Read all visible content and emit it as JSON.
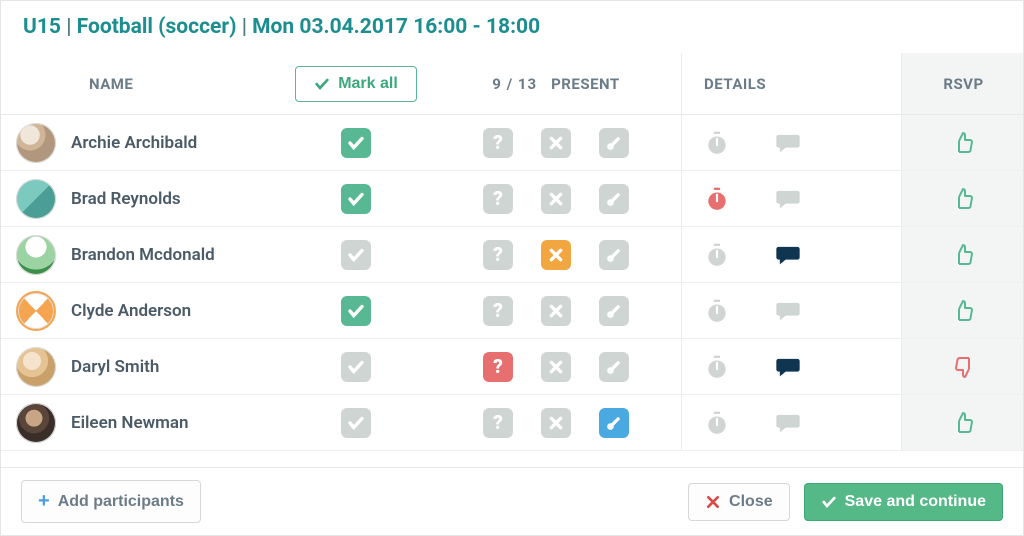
{
  "title": {
    "team": "U15",
    "sport": "Football (soccer)",
    "datetime": "Mon 03.04.2017 16:00 - 18:00"
  },
  "headers": {
    "name": "NAME",
    "mark_all": "Mark all",
    "present_count": "9 / 13",
    "present": "PRESENT",
    "details": "DETAILS",
    "rsvp": "RSVP"
  },
  "rows": [
    {
      "name": "Archie Archibald",
      "check": "green",
      "question": "off",
      "cross": "off",
      "therm": "off",
      "timer": "off",
      "comment": "off",
      "rsvp": "up",
      "avatar": "v0"
    },
    {
      "name": "Brad Reynolds",
      "check": "green",
      "question": "off",
      "cross": "off",
      "therm": "off",
      "timer": "red",
      "comment": "off",
      "rsvp": "up",
      "avatar": "v1"
    },
    {
      "name": "Brandon Mcdonald",
      "check": "off",
      "question": "off",
      "cross": "orange",
      "therm": "off",
      "timer": "off",
      "comment": "dark",
      "rsvp": "up",
      "avatar": "v2"
    },
    {
      "name": "Clyde Anderson",
      "check": "green",
      "question": "off",
      "cross": "off",
      "therm": "off",
      "timer": "off",
      "comment": "off",
      "rsvp": "up",
      "avatar": "v3"
    },
    {
      "name": "Daryl Smith",
      "check": "off",
      "question": "red",
      "cross": "off",
      "therm": "off",
      "timer": "off",
      "comment": "dark",
      "rsvp": "down",
      "avatar": "v4"
    },
    {
      "name": "Eileen Newman",
      "check": "off",
      "question": "off",
      "cross": "off",
      "therm": "blue",
      "timer": "off",
      "comment": "off",
      "rsvp": "up",
      "avatar": "v5"
    }
  ],
  "footer": {
    "add": "Add participants",
    "close": "Close",
    "save": "Save and continue"
  }
}
